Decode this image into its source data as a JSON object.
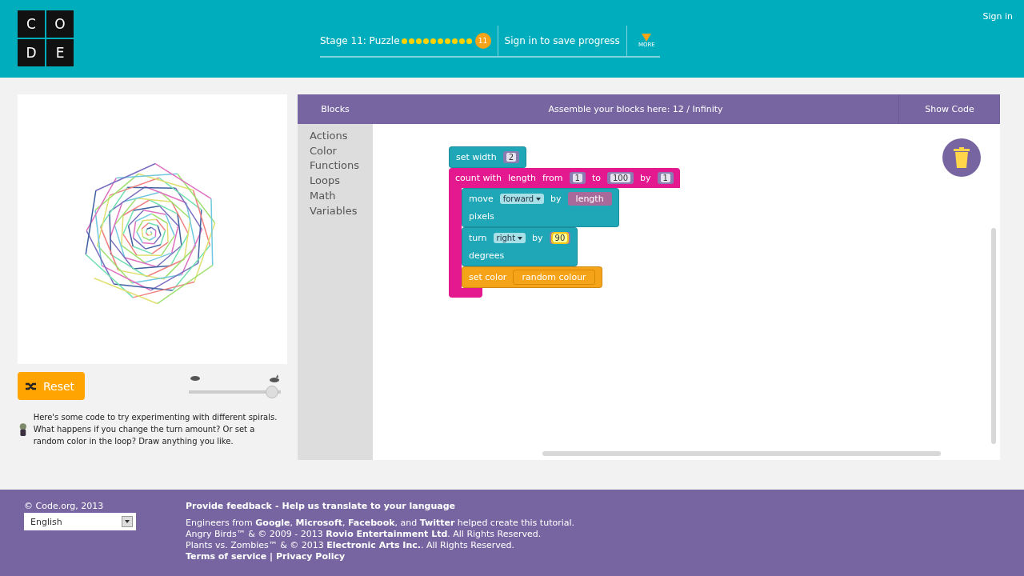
{
  "header": {
    "logo_letters": [
      "C",
      "O",
      "D",
      "E"
    ],
    "stage_label": "Stage 11: Puzzle",
    "levels": [
      {
        "current": false
      },
      {
        "current": false
      },
      {
        "current": false
      },
      {
        "current": false
      },
      {
        "current": false
      },
      {
        "current": false
      },
      {
        "current": false
      },
      {
        "current": false
      },
      {
        "current": false
      },
      {
        "current": false
      },
      {
        "current": true,
        "label": "11"
      }
    ],
    "save_progress": "Sign in to save progress",
    "more": "MORE",
    "sign_in": "Sign in"
  },
  "play_area": {
    "reset_button": "Reset",
    "speed_slider": {
      "level": 0.97
    },
    "instructions": "Here's some code to try experimenting with different spirals. What happens if you change the turn amount? Or set a random color in the loop? Draw anything you like."
  },
  "workspace": {
    "toolbox_header": "Blocks",
    "workspace_header": "Assemble your blocks here: 12 / Infinity",
    "show_code": "Show Code",
    "categories": [
      "Actions",
      "Color",
      "Functions",
      "Loops",
      "Math",
      "Variables"
    ],
    "blocks": [
      {
        "kind": "statement",
        "color": "#1fa7b8",
        "lines": [
          [
            {
              "kind": "text",
              "text": "set width"
            },
            {
              "kind": "number",
              "text": "2"
            }
          ]
        ]
      },
      {
        "kind": "loop",
        "color": "#e4198f",
        "lines": [
          [
            {
              "kind": "text",
              "text": "count with"
            },
            {
              "kind": "text",
              "text": "length"
            },
            {
              "kind": "text",
              "text": "from"
            },
            {
              "kind": "number",
              "text": "1"
            },
            {
              "kind": "text",
              "text": "to"
            },
            {
              "kind": "number",
              "text": "100"
            },
            {
              "kind": "text",
              "text": "by"
            },
            {
              "kind": "number",
              "text": "1"
            }
          ]
        ],
        "children": [
          {
            "kind": "statement",
            "color": "#1fa7b8",
            "lines": [
              [
                {
                  "kind": "text",
                  "text": "move"
                },
                {
                  "kind": "dropdown",
                  "text": "forward"
                },
                {
                  "kind": "text",
                  "text": "by"
                },
                {
                  "kind": "variable",
                  "text": "length"
                }
              ],
              [
                {
                  "kind": "text",
                  "text": "pixels"
                }
              ]
            ]
          },
          {
            "kind": "statement",
            "color": "#1fa7b8",
            "lines": [
              [
                {
                  "kind": "text",
                  "text": "turn"
                },
                {
                  "kind": "dropdown",
                  "text": "right"
                },
                {
                  "kind": "text",
                  "text": "by"
                },
                {
                  "kind": "number",
                  "text": "90",
                  "editing": true
                }
              ],
              [
                {
                  "kind": "text",
                  "text": "degrees"
                }
              ]
            ]
          },
          {
            "kind": "statement",
            "color": "#f5a318",
            "lines": [
              [
                {
                  "kind": "text",
                  "text": "set color"
                },
                {
                  "kind": "color",
                  "text": "random colour"
                }
              ]
            ]
          }
        ]
      }
    ]
  },
  "footer": {
    "copyright": "© Code.org, 2013",
    "language": "English",
    "links": [
      {
        "text": "Provide feedback"
      },
      {
        "text": "Help us translate to your language"
      }
    ],
    "separator": "-",
    "credits": [
      "Engineers from **Google**, **Microsoft**, **Facebook**, and **Twitter** helped create this tutorial.",
      "Angry Birds™ & © 2009 - 2013 **Rovio Entertainment Ltd**. All Rights Reserved.",
      "Plants vs. Zombies™ & © 2013 **Electronic Arts Inc.**. All Rights Reserved.",
      "**Terms of service | Privacy Policy**"
    ]
  }
}
